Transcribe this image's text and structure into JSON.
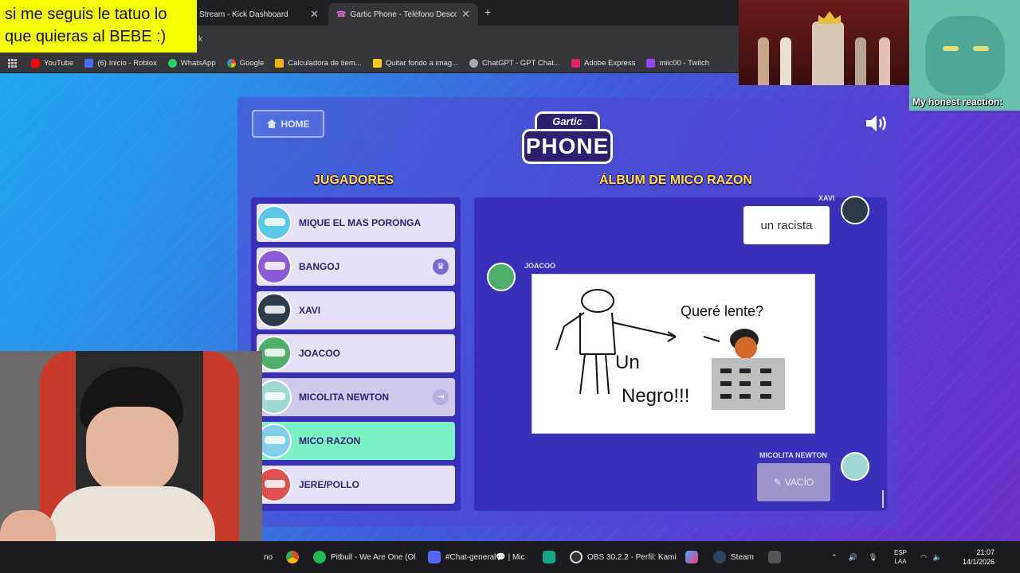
{
  "caption": "si me seguis le tatuo lo que quieras al BEBE :)",
  "reaction_label": "My honest reaction:",
  "browser": {
    "tabs": [
      {
        "label": "Stream - Kick Dashboard"
      },
      {
        "label": "Gartic Phone - Teléfono Descon"
      }
    ],
    "address_fragment": "k",
    "bookmarks": [
      {
        "label": "YouTube",
        "color": "#ff0000"
      },
      {
        "label": "(6) Inicio - Roblox",
        "color": "#4d6cff"
      },
      {
        "label": "WhatsApp",
        "color": "#25d366"
      },
      {
        "label": "Google",
        "color": "#4285f4"
      },
      {
        "label": "Calculadora de tiem...",
        "color": "#f4b400"
      },
      {
        "label": "Quitar fondo a imag...",
        "color": "#ffcc00"
      },
      {
        "label": "ChatGPT - GPT Chat...",
        "color": "#aaaaaa"
      },
      {
        "label": "Adobe Express",
        "color": "#e0245e"
      },
      {
        "label": "miic00 - Twitch",
        "color": "#9146ff"
      }
    ]
  },
  "game": {
    "home_label": "HOME",
    "logo_top": "Gartic",
    "logo_bottom": "PHONE",
    "players_title": "JUGADORES",
    "album_title": "ÁLBUM DE MICO RAZON",
    "players": [
      {
        "name": "MIQUE EL MAS PORONGA",
        "avatar_color": "#5bc8e8"
      },
      {
        "name": "BANGOJ",
        "avatar_color": "#8b5bd6",
        "badge": "♛"
      },
      {
        "name": "XAVI",
        "avatar_color": "#2d3a48"
      },
      {
        "name": "JOACOO",
        "avatar_color": "#4fae6a"
      },
      {
        "name": "MICOLITA NEWTON",
        "avatar_color": "#9fd8d0",
        "badge": "⇥"
      },
      {
        "name": "MICO RAZON",
        "avatar_color": "#7fd0e8"
      },
      {
        "name": "JERE/POLLO",
        "avatar_color": "#e05050"
      }
    ],
    "album": {
      "top_author": "XAVI",
      "bubble_text": "un racista",
      "drawing_author": "JOACOO",
      "drawing_texts": [
        "Queré lente?",
        "Un",
        "Negro!!!"
      ],
      "last_author": "MICOLITA NEWTON",
      "last_text": "VACÍO"
    }
  },
  "taskbar": {
    "items": [
      {
        "label": "no"
      },
      {
        "label": "Pitbull - We Are One (Ol",
        "color": "#1db954"
      },
      {
        "label": "#Chat-general💬 | Mic",
        "color": "#5865f2"
      },
      {
        "label": "OBS 30.2.2 - Perfil: Kami",
        "color": "#333333"
      },
      {
        "label": "Steam",
        "color": "#2a475e"
      }
    ],
    "lang": "ESP",
    "lang2": "LAA",
    "time": "21:07",
    "date": "14/1/2026"
  }
}
